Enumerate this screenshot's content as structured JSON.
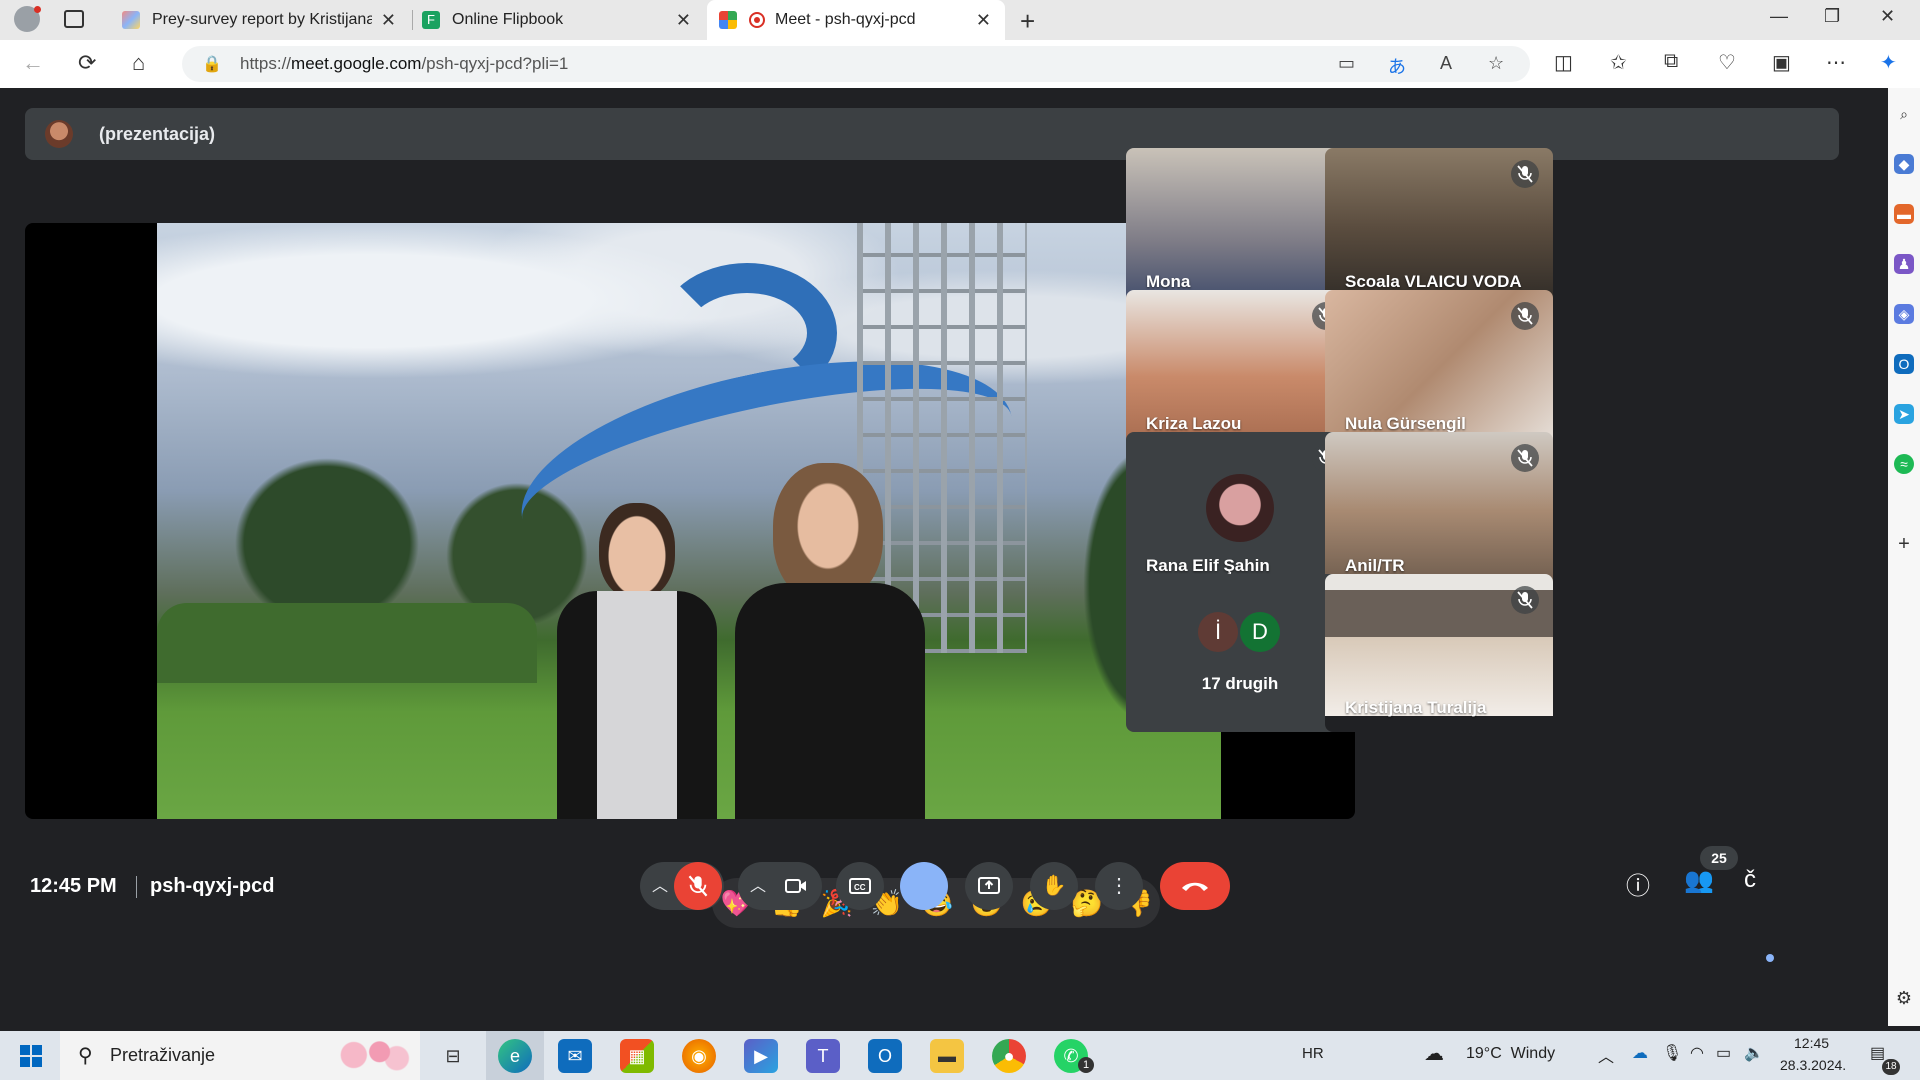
{
  "browser": {
    "tabs": [
      {
        "title": "Prey-survey report by Kristijana T",
        "active": false
      },
      {
        "title": "Online Flipbook",
        "active": false
      },
      {
        "title": "Meet - psh-qyxj-pcd",
        "active": true
      }
    ],
    "url_prefix": "https://",
    "url_domain": "meet.google.com",
    "url_path": "/psh-qyxj-pcd?pli=1",
    "new_tab_label": "+"
  },
  "meet": {
    "presenter_label": "(prezentacija)",
    "participants": [
      {
        "name": "Mona",
        "muted": false
      },
      {
        "name": "Scoala VLAICU VODA",
        "muted": true
      },
      {
        "name": "Kriza Lazou",
        "muted": true
      },
      {
        "name": "Nula Gürsengil",
        "muted": true
      },
      {
        "name": "Rana Elif Şahin",
        "muted": true
      },
      {
        "name": "Anil/TR",
        "muted": true
      },
      {
        "name": "Kristijana Turalija",
        "muted": true
      }
    ],
    "others": {
      "initials": [
        "İ",
        "D"
      ],
      "label": "17 drugih"
    },
    "reactions": [
      "💖",
      "👍",
      "🎉",
      "👏",
      "😂",
      "😮",
      "😢",
      "🤔",
      "👎"
    ],
    "time": "12:45 PM",
    "meeting_code": "psh-qyxj-pcd",
    "participant_count": "25",
    "caption_letter": "č"
  },
  "taskbar": {
    "search_placeholder": "Pretraživanje",
    "language": "HR",
    "weather": "19°C  Windy",
    "clock_time": "12:45",
    "clock_date": "28.3.2024.",
    "whatsapp_badge": "1",
    "notification_count": "18"
  },
  "colors": {
    "meet_bg": "#202124",
    "end_call": "#ea4335",
    "mic_off": "#ea4335",
    "accent": "#8ab4f8"
  }
}
